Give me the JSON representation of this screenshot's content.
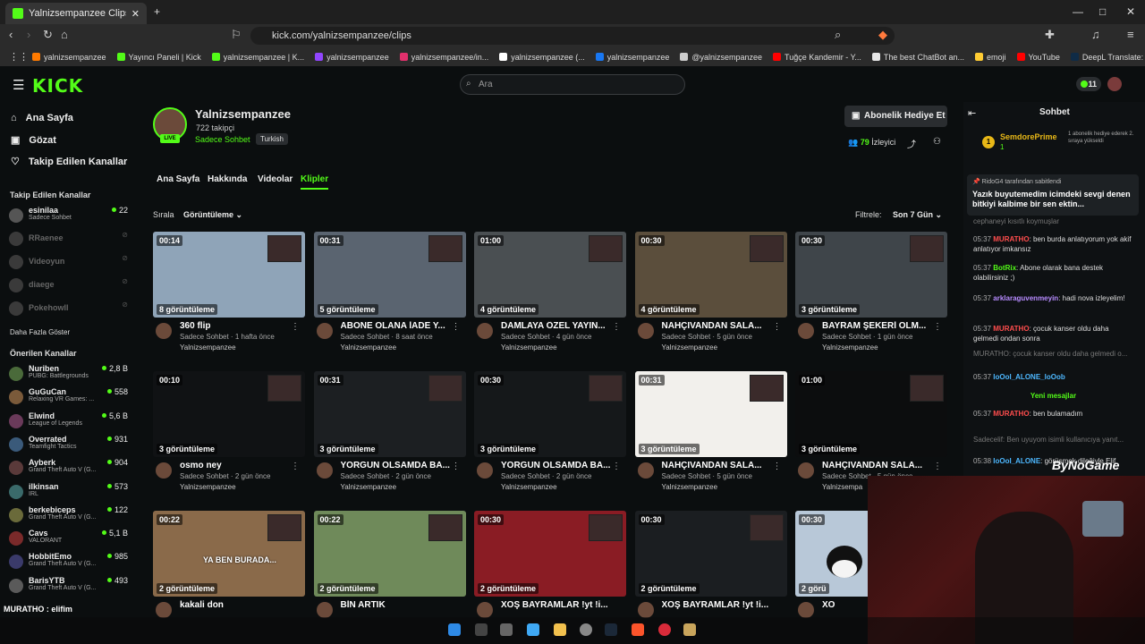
{
  "browser": {
    "tab_title": "Yalnizsempanzee Clips - Watc",
    "url": "kick.com/yalnizsempanzee/clips",
    "bookmarks": [
      {
        "label": "yalnizsempanzee",
        "color": "#ff7a00"
      },
      {
        "label": "Yayıncı Paneli | Kick",
        "color": "#53fc18"
      },
      {
        "label": "yalnizsempanzee | K...",
        "color": "#53fc18"
      },
      {
        "label": "yalnizsempanzee",
        "color": "#9146ff"
      },
      {
        "label": "yalnizsempanzee/in...",
        "color": "#e1306c"
      },
      {
        "label": "yalnizsempanzee (...",
        "color": "#ffffff"
      },
      {
        "label": "yalnizsempanzee",
        "color": "#1877f2"
      },
      {
        "label": "@yalnizsempanzee",
        "color": "#cccccc"
      },
      {
        "label": "Tuğçe Kandemir - Y...",
        "color": "#ff0000"
      },
      {
        "label": "The best ChatBot an...",
        "color": "#e8e8e8"
      },
      {
        "label": "emoji",
        "color": "#ffcc33"
      },
      {
        "label": "YouTube",
        "color": "#ff0000"
      },
      {
        "label": "DeepL Translate: Dü...",
        "color": "#0f2b46"
      }
    ]
  },
  "header": {
    "logo": "KICK",
    "search_placeholder": "Ara",
    "points": "11"
  },
  "sidebar": {
    "nav": [
      {
        "label": "Ana Sayfa",
        "icon": "home-icon"
      },
      {
        "label": "Gözat",
        "icon": "browse-icon"
      },
      {
        "label": "Takip Edilen Kanallar",
        "icon": "heart-icon"
      }
    ],
    "followed_heading": "Takip Edilen Kanallar",
    "followed": [
      {
        "name": "esinilaa",
        "sub": "Sadece Sohbet",
        "viewers": "22",
        "online": true
      },
      {
        "name": "RRaenee",
        "online": false
      },
      {
        "name": "Videoyun",
        "online": false
      },
      {
        "name": "diaege",
        "online": false
      },
      {
        "name": "Pokehowll",
        "online": false
      }
    ],
    "show_more": "Daha Fazla Göster",
    "recommended_heading": "Önerilen Kanallar",
    "recommended": [
      {
        "name": "Nuriben",
        "sub": "PUBG: Battlegrounds",
        "viewers": "2,8 B"
      },
      {
        "name": "GuGuCan",
        "sub": "Relaxing VR Games: ...",
        "viewers": "558"
      },
      {
        "name": "Elwind",
        "sub": "League of Legends",
        "viewers": "5,6 B"
      },
      {
        "name": "Overrated",
        "sub": "Teamfight Tactics",
        "viewers": "931"
      },
      {
        "name": "Ayberk",
        "sub": "Grand Theft Auto V (G...",
        "viewers": "904"
      },
      {
        "name": "ilkinsan",
        "sub": "IRL",
        "viewers": "573"
      },
      {
        "name": "berkebiceps",
        "sub": "Grand Theft Auto V (G...",
        "viewers": "122"
      },
      {
        "name": "Cavs",
        "sub": "VALORANT",
        "viewers": "5,1 B"
      },
      {
        "name": "HobbitEmo",
        "sub": "Grand Theft Auto V (G...",
        "viewers": "985"
      },
      {
        "name": "BarisYTB",
        "sub": "Grand Theft Auto V (G...",
        "viewers": "493"
      }
    ],
    "bottom_overlay": "MURATHO : elifim"
  },
  "channel": {
    "name": "Yalnizsempanzee",
    "followers": "722 takipçi",
    "category": "Sadece Sohbet",
    "language": "Turkish",
    "live_badge": "LIVE",
    "gift_button": "Abonelik Hediye Et",
    "viewers_count": "79",
    "viewers_label": "İzleyici",
    "tabs": [
      "Ana Sayfa",
      "Hakkında",
      "Videolar",
      "Klipler"
    ],
    "sort_label": "Sırala",
    "sort_value": "Görüntüleme",
    "filter_label": "Filtrele:",
    "filter_value": "Son 7 Gün"
  },
  "clips": [
    {
      "duration": "00:14",
      "views": "8 görüntüleme",
      "title": "360 flip",
      "meta": "Sadece Sohbet · 1 hafta önce",
      "channel": "Yalnizsempanzee",
      "bg": "#8fa4b8"
    },
    {
      "duration": "00:31",
      "views": "5 görüntüleme",
      "title": "ABONE OLANA İADE Y...",
      "meta": "Sadece Sohbet · 8 saat önce",
      "channel": "Yalnizsempanzee",
      "bg": "#5a6470"
    },
    {
      "duration": "01:00",
      "views": "4 görüntüleme",
      "title": "DAMLAYA ÖZEL YAYIN...",
      "meta": "Sadece Sohbet · 4 gün önce",
      "channel": "Yalnizsempanzee",
      "bg": "#4a4f52"
    },
    {
      "duration": "00:30",
      "views": "4 görüntüleme",
      "title": "NAHÇIVANDAN SALA...",
      "meta": "Sadece Sohbet · 5 gün önce",
      "channel": "Yalnizsempanzee",
      "bg": "#5b4e3c"
    },
    {
      "duration": "00:30",
      "views": "3 görüntüleme",
      "title": "BAYRAM ŞEKERİ OLM...",
      "meta": "Sadece Sohbet · 1 gün önce",
      "channel": "Yalnizsempanzee",
      "bg": "#3f454a"
    },
    {
      "duration": "00:10",
      "views": "3 görüntüleme",
      "title": "osmo ney",
      "meta": "Sadece Sohbet · 2 gün önce",
      "channel": "Yalnizsempanzee",
      "bg": "#101214"
    },
    {
      "duration": "00:31",
      "views": "3 görüntüleme",
      "title": "YORGUN OLSAMDA BA...",
      "meta": "Sadece Sohbet · 2 gün önce",
      "channel": "Yalnizsempanzee",
      "bg": "#1c1f22"
    },
    {
      "duration": "00:30",
      "views": "3 görüntüleme",
      "title": "YORGUN OLSAMDA BA...",
      "meta": "Sadece Sohbet · 2 gün önce",
      "channel": "Yalnizsempanzee",
      "bg": "#15181a"
    },
    {
      "duration": "00:31",
      "views": "3 görüntüleme",
      "title": "NAHÇIVANDAN SALA...",
      "meta": "Sadece Sohbet · 5 gün önce",
      "channel": "Yalnizsempanzee",
      "bg": "#f2f0ec"
    },
    {
      "duration": "01:00",
      "views": "3 görüntüleme",
      "title": "NAHÇIVANDAN SALA...",
      "meta": "Sadece Sohbet · 5 gün önce",
      "channel": "Yalnizsempa",
      "bg": "#0c0d0e"
    },
    {
      "duration": "00:22",
      "views": "2 görüntüleme",
      "title": "kakali don",
      "meta": "",
      "channel": "",
      "bg": "#8a6a4a",
      "caption": "YA BEN BURADA..."
    },
    {
      "duration": "00:22",
      "views": "2 görüntüleme",
      "title": "BİN ARTIK",
      "meta": "",
      "channel": "",
      "bg": "#6f8a5a"
    },
    {
      "duration": "00:30",
      "views": "2 görüntüleme",
      "title": "XOŞ BAYRAMLAR !yt !i...",
      "meta": "",
      "channel": "",
      "bg": "#8a1c24"
    },
    {
      "duration": "00:30",
      "views": "2 görüntüleme",
      "title": "XOŞ BAYRAMLAR !yt !i...",
      "meta": "",
      "channel": "",
      "bg": "#1b1e21"
    },
    {
      "duration": "00:30",
      "views": "2 görü",
      "title": "XO",
      "meta": "",
      "channel": "",
      "bg": "#b8c8d8"
    }
  ],
  "chat": {
    "title": "Sohbet",
    "sub_gift_user": "SemdorePrime",
    "sub_gift_count": "1",
    "sub_gift_text": "1 abonelik hediye ederek 2. sıraya yükseldi",
    "pinned_by": "RidoG4 tarafından sabitlendi",
    "pinned_text": "Yazık buyutemedim icimdeki sevgi denen bitkiyi kalbime bir sen ektin...",
    "new_messages": "Yeni mesajlar",
    "messages": [
      {
        "time": "",
        "user": "",
        "text": "cephaneyi kısıtlı koymuşlar",
        "color": "#ddd"
      },
      {
        "time": "05:37",
        "user": "MURATHO",
        "text": "ben burda anlatıyorum yok akif anlatıyor imkansız",
        "color": "#ff4d4d"
      },
      {
        "time": "05:37",
        "user": "BotRix",
        "text": "Abone olarak bana destek olabilirsiniz ;)",
        "color": "#53fc18"
      },
      {
        "time": "05:37",
        "user": "arklaraguvenmeyin",
        "text": "hadi nova izleyelim!",
        "color": "#b78bff"
      },
      {
        "time": "05:37",
        "user": "MURATHO",
        "text": "çocuk kanser oldu daha gelmedi ondan sonra",
        "color": "#ff4d4d"
      },
      {
        "time": "",
        "user": "",
        "text": "MURATHO: çocuk kanser oldu daha gelmedi o...",
        "color": "#777"
      },
      {
        "time": "05:37",
        "user": "loOol_ALONE_loOob",
        "text": "",
        "color": "#4db8ff"
      },
      {
        "time": "05:37",
        "user": "MURATHO",
        "text": "ben bulamadım",
        "color": "#ff4d4d"
      },
      {
        "time": "",
        "user": "",
        "text": "Sadecelif: Ben uyuyom isimli kullanıcıya yanıt...",
        "color": "#777"
      },
      {
        "time": "05:38",
        "user": "loOol_ALONE",
        "text": "görüşmek dileğiyle Elif",
        "color": "#4db8ff"
      }
    ]
  },
  "overlay": {
    "cam_logo": "ByNoGame"
  }
}
